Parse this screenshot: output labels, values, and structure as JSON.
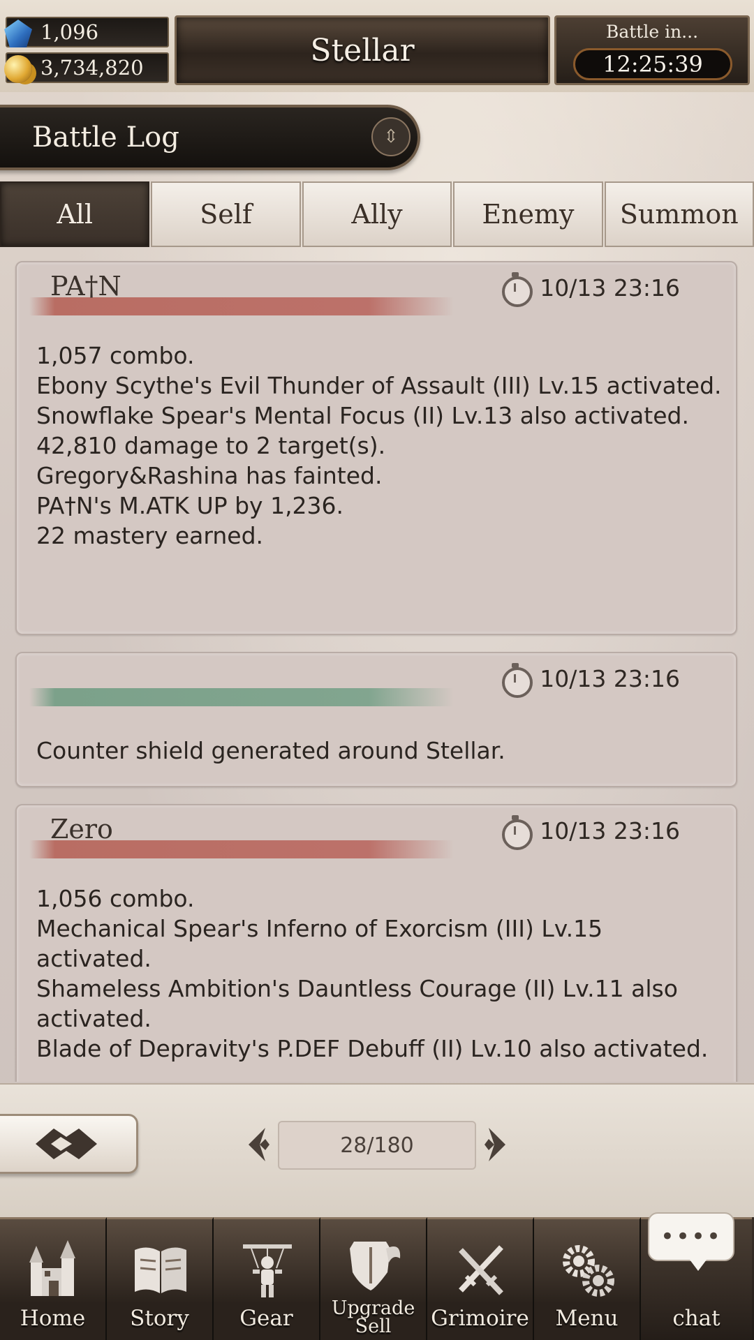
{
  "header": {
    "gems": "1,096",
    "gold": "3,734,820",
    "title": "Stellar",
    "battle_label": "Battle in...",
    "battle_timer": "12:25:39"
  },
  "battle_log": {
    "title": "Battle Log",
    "tabs": [
      {
        "label": "All",
        "active": true
      },
      {
        "label": "Self",
        "active": false
      },
      {
        "label": "Ally",
        "active": false
      },
      {
        "label": "Enemy",
        "active": false
      },
      {
        "label": "Summon",
        "active": false
      }
    ]
  },
  "entries": [
    {
      "actor": "PA†N",
      "faction": "enemy",
      "time": "10/13 23:16",
      "lines": [
        "1,057 combo.",
        "Ebony Scythe's Evil Thunder of Assault (III) Lv.15 activated.",
        "Snowflake Spear's Mental Focus (II) Lv.13 also activated.",
        "42,810 damage to 2 target(s).",
        "Gregory&Rashina has fainted.",
        "PA†N's M.ATK UP by 1,236.",
        "22 mastery earned."
      ]
    },
    {
      "actor": "",
      "faction": "ally",
      "time": "10/13 23:16",
      "lines": [
        "Counter shield generated around Stellar."
      ]
    },
    {
      "actor": "Zero",
      "faction": "enemy",
      "time": "10/13 23:16",
      "lines": [
        "1,056 combo.",
        "Mechanical Spear's Inferno of Exorcism (III) Lv.15 activated.",
        "Shameless Ambition's Dauntless Courage (II) Lv.11 also activated.",
        "Blade of Depravity's P.DEF Debuff (II) Lv.10 also activated."
      ]
    }
  ],
  "pager": {
    "page": "28/180"
  },
  "nav": [
    {
      "label": "Home",
      "icon": "castle-icon"
    },
    {
      "label": "Story",
      "icon": "book-icon"
    },
    {
      "label": "Gear",
      "icon": "puppet-icon"
    },
    {
      "label": "Upgrade Sell",
      "icon": "shield-icon"
    },
    {
      "label": "Grimoire",
      "icon": "crossed-swords-icon"
    },
    {
      "label": "Menu",
      "icon": "gears-icon"
    },
    {
      "label": "chat",
      "icon": "chat-bubble-icon"
    }
  ],
  "chat_bubble": "••••",
  "colors": {
    "enemy_stripe": "#b45d52",
    "ally_stripe": "#6c9a80",
    "active_tab": "#4d4238"
  }
}
